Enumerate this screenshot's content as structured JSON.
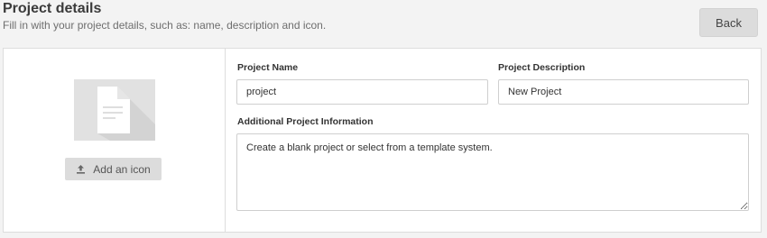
{
  "header": {
    "title": "Project details",
    "subtitle": "Fill in with your project details, such as: name, description and icon.",
    "back_label": "Back"
  },
  "icon_panel": {
    "add_icon_label": "Add an icon",
    "preview_icon": "document-icon",
    "button_icon": "upload-icon"
  },
  "form": {
    "name_label": "Project Name",
    "name_value": "project",
    "description_label": "Project Description",
    "description_value": "New Project",
    "info_label": "Additional Project Information",
    "info_value": "Create a blank project or select from a template system."
  }
}
